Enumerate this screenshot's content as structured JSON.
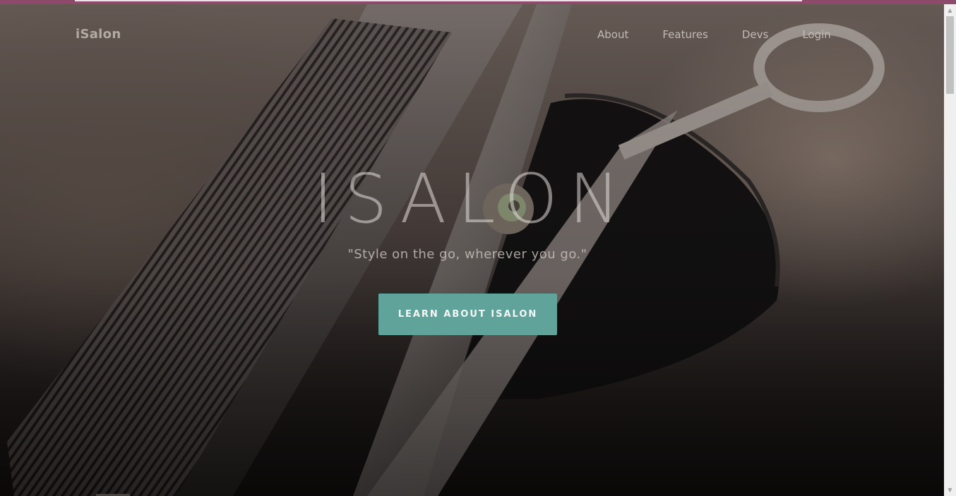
{
  "brand": "iSalon",
  "nav": {
    "about": "About",
    "features": "Features",
    "devs": "Devs",
    "login": "Login"
  },
  "hero": {
    "title": "ISALON",
    "tagline": "\"Style on the go, wherever you go.\"",
    "cta_label": "LEARN ABOUT ISALON"
  },
  "colors": {
    "accent": "#5fa39b",
    "browser_bar": "#8e4a6b"
  },
  "icons": {
    "scroll_up": "scroll-up-arrow-icon",
    "scroll_down": "scroll-down-arrow-icon"
  }
}
